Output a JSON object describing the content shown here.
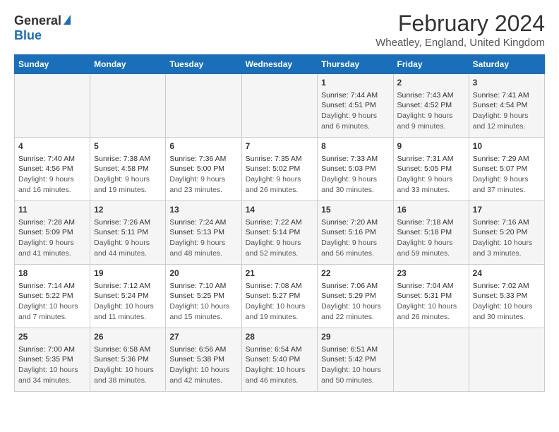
{
  "logo": {
    "general": "General",
    "blue": "Blue"
  },
  "title": "February 2024",
  "subtitle": "Wheatley, England, United Kingdom",
  "days_of_week": [
    "Sunday",
    "Monday",
    "Tuesday",
    "Wednesday",
    "Thursday",
    "Friday",
    "Saturday"
  ],
  "weeks": [
    [
      {
        "day": "",
        "info": ""
      },
      {
        "day": "",
        "info": ""
      },
      {
        "day": "",
        "info": ""
      },
      {
        "day": "",
        "info": ""
      },
      {
        "day": "1",
        "sunrise": "7:44 AM",
        "sunset": "4:51 PM",
        "daylight": "9 hours and 6 minutes."
      },
      {
        "day": "2",
        "sunrise": "7:43 AM",
        "sunset": "4:52 PM",
        "daylight": "9 hours and 9 minutes."
      },
      {
        "day": "3",
        "sunrise": "7:41 AM",
        "sunset": "4:54 PM",
        "daylight": "9 hours and 12 minutes."
      }
    ],
    [
      {
        "day": "4",
        "sunrise": "7:40 AM",
        "sunset": "4:56 PM",
        "daylight": "9 hours and 16 minutes."
      },
      {
        "day": "5",
        "sunrise": "7:38 AM",
        "sunset": "4:58 PM",
        "daylight": "9 hours and 19 minutes."
      },
      {
        "day": "6",
        "sunrise": "7:36 AM",
        "sunset": "5:00 PM",
        "daylight": "9 hours and 23 minutes."
      },
      {
        "day": "7",
        "sunrise": "7:35 AM",
        "sunset": "5:02 PM",
        "daylight": "9 hours and 26 minutes."
      },
      {
        "day": "8",
        "sunrise": "7:33 AM",
        "sunset": "5:03 PM",
        "daylight": "9 hours and 30 minutes."
      },
      {
        "day": "9",
        "sunrise": "7:31 AM",
        "sunset": "5:05 PM",
        "daylight": "9 hours and 33 minutes."
      },
      {
        "day": "10",
        "sunrise": "7:29 AM",
        "sunset": "5:07 PM",
        "daylight": "9 hours and 37 minutes."
      }
    ],
    [
      {
        "day": "11",
        "sunrise": "7:28 AM",
        "sunset": "5:09 PM",
        "daylight": "9 hours and 41 minutes."
      },
      {
        "day": "12",
        "sunrise": "7:26 AM",
        "sunset": "5:11 PM",
        "daylight": "9 hours and 44 minutes."
      },
      {
        "day": "13",
        "sunrise": "7:24 AM",
        "sunset": "5:13 PM",
        "daylight": "9 hours and 48 minutes."
      },
      {
        "day": "14",
        "sunrise": "7:22 AM",
        "sunset": "5:14 PM",
        "daylight": "9 hours and 52 minutes."
      },
      {
        "day": "15",
        "sunrise": "7:20 AM",
        "sunset": "5:16 PM",
        "daylight": "9 hours and 56 minutes."
      },
      {
        "day": "16",
        "sunrise": "7:18 AM",
        "sunset": "5:18 PM",
        "daylight": "9 hours and 59 minutes."
      },
      {
        "day": "17",
        "sunrise": "7:16 AM",
        "sunset": "5:20 PM",
        "daylight": "10 hours and 3 minutes."
      }
    ],
    [
      {
        "day": "18",
        "sunrise": "7:14 AM",
        "sunset": "5:22 PM",
        "daylight": "10 hours and 7 minutes."
      },
      {
        "day": "19",
        "sunrise": "7:12 AM",
        "sunset": "5:24 PM",
        "daylight": "10 hours and 11 minutes."
      },
      {
        "day": "20",
        "sunrise": "7:10 AM",
        "sunset": "5:25 PM",
        "daylight": "10 hours and 15 minutes."
      },
      {
        "day": "21",
        "sunrise": "7:08 AM",
        "sunset": "5:27 PM",
        "daylight": "10 hours and 19 minutes."
      },
      {
        "day": "22",
        "sunrise": "7:06 AM",
        "sunset": "5:29 PM",
        "daylight": "10 hours and 22 minutes."
      },
      {
        "day": "23",
        "sunrise": "7:04 AM",
        "sunset": "5:31 PM",
        "daylight": "10 hours and 26 minutes."
      },
      {
        "day": "24",
        "sunrise": "7:02 AM",
        "sunset": "5:33 PM",
        "daylight": "10 hours and 30 minutes."
      }
    ],
    [
      {
        "day": "25",
        "sunrise": "7:00 AM",
        "sunset": "5:35 PM",
        "daylight": "10 hours and 34 minutes."
      },
      {
        "day": "26",
        "sunrise": "6:58 AM",
        "sunset": "5:36 PM",
        "daylight": "10 hours and 38 minutes."
      },
      {
        "day": "27",
        "sunrise": "6:56 AM",
        "sunset": "5:38 PM",
        "daylight": "10 hours and 42 minutes."
      },
      {
        "day": "28",
        "sunrise": "6:54 AM",
        "sunset": "5:40 PM",
        "daylight": "10 hours and 46 minutes."
      },
      {
        "day": "29",
        "sunrise": "6:51 AM",
        "sunset": "5:42 PM",
        "daylight": "10 hours and 50 minutes."
      },
      {
        "day": "",
        "info": ""
      },
      {
        "day": "",
        "info": ""
      }
    ]
  ]
}
